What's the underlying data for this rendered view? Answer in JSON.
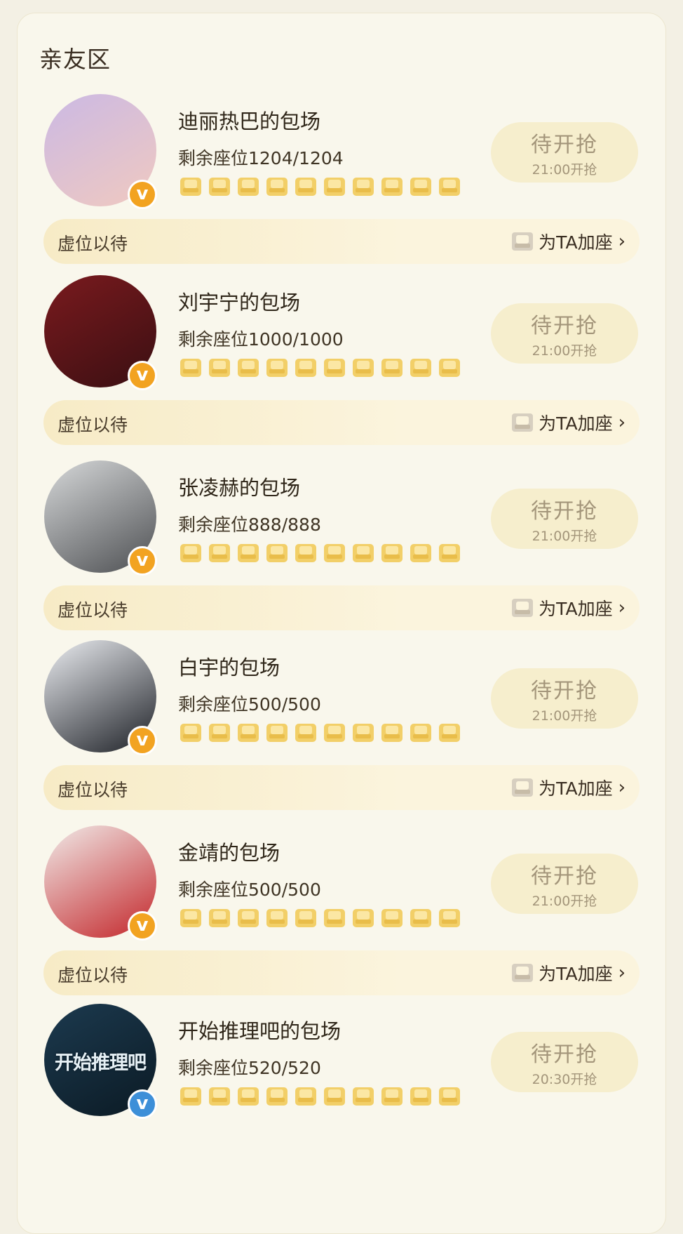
{
  "section": {
    "title": "亲友区"
  },
  "cards": [
    {
      "name": "迪丽热巴的包场",
      "seats": "剩余座位1204/1204",
      "status": "待开抢",
      "time": "21:00开抢",
      "waiting": "虚位以待",
      "add_seat": "为TA加座",
      "avatar_colors": [
        "#cbb9e4",
        "#f0c9c0"
      ]
    },
    {
      "name": "刘宇宁的包场",
      "seats": "剩余座位1000/1000",
      "status": "待开抢",
      "time": "21:00开抢",
      "waiting": "虚位以待",
      "add_seat": "为TA加座",
      "avatar_colors": [
        "#7a1a1e",
        "#3a0f12"
      ]
    },
    {
      "name": "张凌赫的包场",
      "seats": "剩余座位888/888",
      "status": "待开抢",
      "time": "21:00开抢",
      "waiting": "虚位以待",
      "add_seat": "为TA加座",
      "avatar_colors": [
        "#d7d9da",
        "#4d4f52"
      ]
    },
    {
      "name": "白宇的包场",
      "seats": "剩余座位500/500",
      "status": "待开抢",
      "time": "21:00开抢",
      "waiting": "虚位以待",
      "add_seat": "为TA加座",
      "avatar_colors": [
        "#eceef2",
        "#1d2026"
      ]
    },
    {
      "name": "金靖的包场",
      "seats": "剩余座位500/500",
      "status": "待开抢",
      "time": "21:00开抢",
      "waiting": "虚位以待",
      "add_seat": "为TA加座",
      "avatar_colors": [
        "#f1ecea",
        "#c3262a"
      ]
    },
    {
      "name": "开始推理吧的包场",
      "seats": "剩余座位520/520",
      "status": "待开抢",
      "time": "20:30开抢",
      "waiting": "",
      "add_seat": "",
      "avatar_text": "开始推理吧",
      "avatar_colors": [
        "#1c3a4f",
        "#0b1a24"
      ]
    }
  ],
  "theme": {
    "seat_color": "#f2cf68",
    "accent": "#f2a321",
    "status_text": "#a3957a"
  }
}
